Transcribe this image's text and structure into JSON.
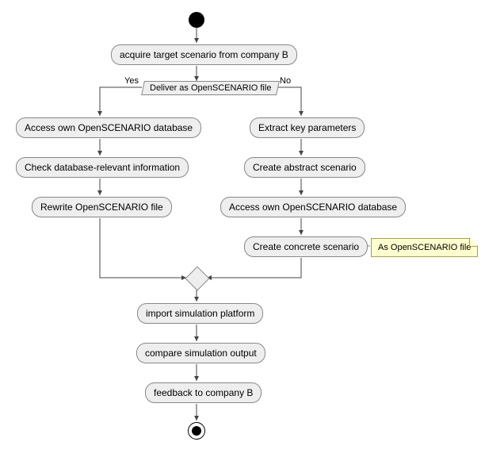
{
  "chart_data": {
    "type": "activity-diagram",
    "start": true,
    "end": true,
    "activities": {
      "acquire": "acquire target scenario from company B",
      "decision1_label": "Deliver as OpenSCENARIO file",
      "decision1_yes": "Yes",
      "decision1_no": "No",
      "yes_branch": [
        "Access own OpenSCENARIO database",
        "Check database-relevant information",
        "Rewrite OpenSCENARIO file"
      ],
      "no_branch": [
        "Extract key parameters",
        "Create abstract scenario",
        "Access own OpenSCENARIO database",
        "Create concrete scenario"
      ],
      "note_on_concrete": "As OpenSCENARIO file",
      "after_merge": [
        "import simulation platform",
        "compare simulation output",
        "feedback to company B"
      ]
    }
  }
}
